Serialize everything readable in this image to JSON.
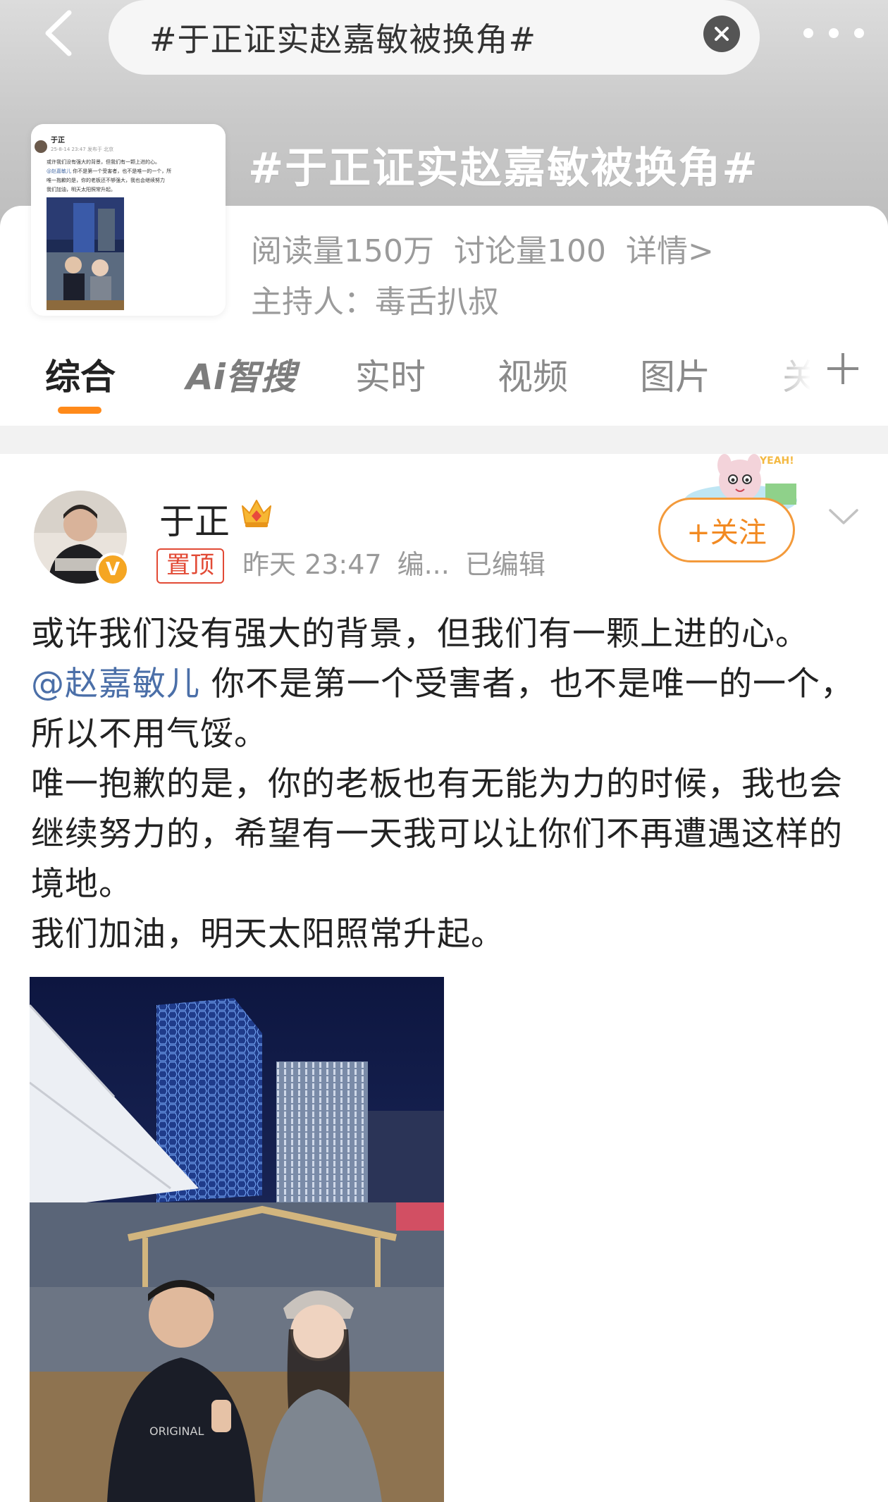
{
  "search": {
    "query": "#于正证实赵嘉敏被换角#"
  },
  "topic": {
    "title": "#于正证实赵嘉敏被换角#",
    "reads": "阅读量150万",
    "discussions": "讨论量100",
    "details": "详情>",
    "host": "主持人：毒舌扒叔",
    "thumb_name": "于正",
    "thumb_meta": "25-8-14 23:47 发布于 北京",
    "thumb_lines": [
      "或许我们没有强大的背景，但我们有一颗上进的心。",
      "@赵嘉敏儿 你不是第一个受害者，也不是唯一的一个，所",
      "唯一抱歉的是，你的老板还不够强大，我也会继续努力的",
      "我们加油，明天太阳照常升起。"
    ]
  },
  "tabs": [
    {
      "label": "综合",
      "active": true
    },
    {
      "label": "Ai智搜",
      "active": false
    },
    {
      "label": "实时",
      "active": false
    },
    {
      "label": "视频",
      "active": false
    },
    {
      "label": "图片",
      "active": false
    },
    {
      "label": "关",
      "active": false
    }
  ],
  "post": {
    "author": "于正",
    "pin_label": "置顶",
    "time": "昨天 23:47",
    "edit_short": "编...",
    "edited": "已编辑",
    "follow_label": "+关注",
    "sticker_text": "YEAH!",
    "para1": "或许我们没有强大的背景，但我们有一颗上进的心。",
    "mention": "@赵嘉敏儿",
    "para2_rest": " 你不是第一个受害者，也不是唯一的一个，所以不用气馁。",
    "para3": "唯一抱歉的是，你的老板也有无能为力的时候，我也会继续努力的，希望有一天我可以让你们不再遭遇这样的境地。",
    "para4": "我们加油，明天太阳照常升起。"
  },
  "colors": {
    "accent_orange": "#ff8a1a",
    "follow_orange": "#f28a22",
    "mention_blue": "#4b6fa8",
    "pin_red": "#e24a35"
  },
  "icons": [
    "back-arrow-icon",
    "clear-icon",
    "more-icon",
    "plus-icon",
    "crown-icon",
    "verified-v-icon",
    "chevron-down-icon"
  ]
}
